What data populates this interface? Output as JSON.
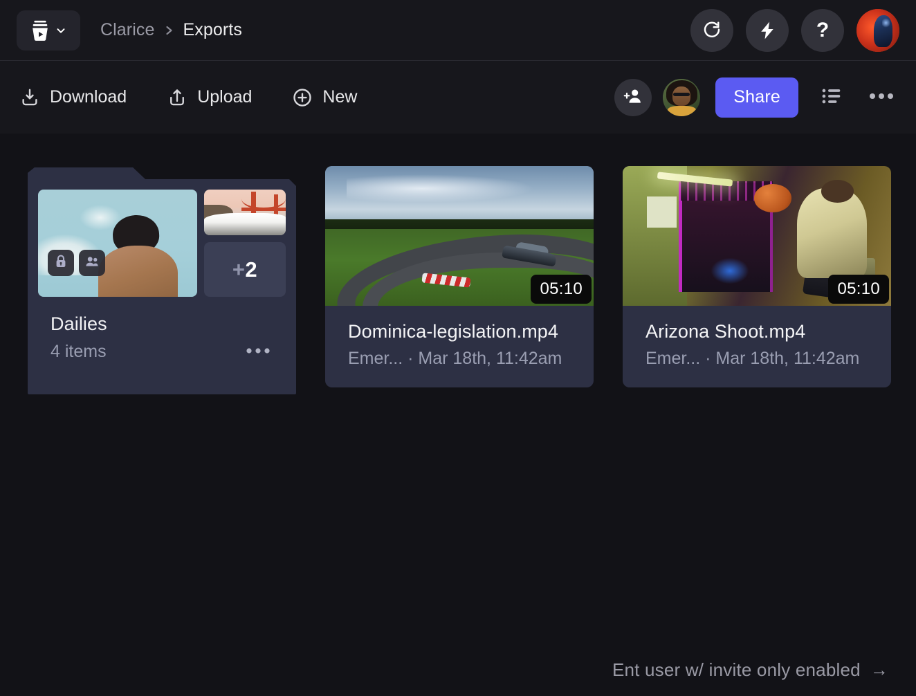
{
  "header": {
    "logo_icon": "frameio-bucket-play-icon",
    "logo_chevron_icon": "chevron-down-icon",
    "breadcrumb": {
      "parent": "Clarice",
      "separator_icon": "chevron-right-icon",
      "current": "Exports"
    },
    "actions": [
      {
        "name": "refresh",
        "icon": "refresh-clockwise-icon",
        "label": ""
      },
      {
        "name": "lightning",
        "icon": "lightning-bolt-icon",
        "label": ""
      },
      {
        "name": "help",
        "icon": "question-mark-icon",
        "label": "?"
      }
    ],
    "account_avatar": "user-avatar"
  },
  "toolbar": {
    "download_label": "Download",
    "download_icon": "download-icon",
    "upload_label": "Upload",
    "upload_icon": "upload-icon",
    "new_label": "New",
    "new_icon": "plus-circle-icon",
    "invite_icon": "add-person-icon",
    "collaborator_avatar": "collaborator-avatar",
    "share_label": "Share",
    "share_color": "#5B5BF2",
    "list_view_icon": "list-view-icon",
    "overflow_icon": "more-horizontal-icon"
  },
  "content": {
    "folder": {
      "title": "Dailies",
      "item_count": "4 items",
      "more_plus": "+",
      "more_count": "2",
      "badges": [
        {
          "name": "lock",
          "icon": "lock-icon"
        },
        {
          "name": "shared",
          "icon": "people-group-icon"
        }
      ],
      "overflow_icon": "more-horizontal-icon"
    },
    "assets": [
      {
        "title": "Dominica-legislation.mp4",
        "subtitle": "Emer... · Mar 18th, 11:42am",
        "duration": "05:10",
        "thumb": "race-track"
      },
      {
        "title": "Arizona Shoot.mp4",
        "subtitle": "Emer... · Mar 18th, 11:42am",
        "duration": "05:10",
        "thumb": "arizona-shoot"
      }
    ]
  },
  "footer": {
    "note": "Ent user w/ invite only enabled",
    "arrow": "→"
  },
  "colors": {
    "page_bg": "#121217",
    "chrome_bg": "#17171C",
    "card_bg": "#2D3044",
    "accent": "#5B5BF2",
    "text_primary": "#F2F2F4",
    "text_secondary": "#9A9EB2"
  }
}
